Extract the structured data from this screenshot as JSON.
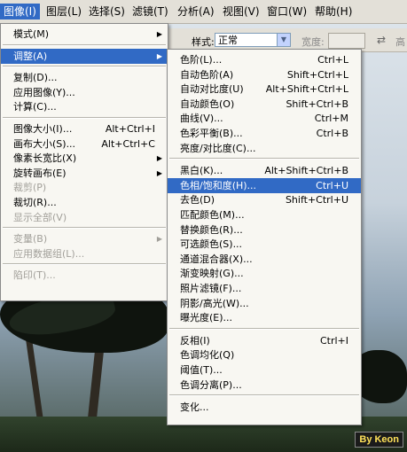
{
  "menubar": [
    {
      "label": "图像(I)",
      "active": true
    },
    {
      "label": "图层(L)"
    },
    {
      "label": "选择(S)"
    },
    {
      "label": "滤镜(T)"
    },
    {
      "label": "分析(A)"
    },
    {
      "label": "视图(V)"
    },
    {
      "label": "窗口(W)"
    },
    {
      "label": "帮助(H)"
    }
  ],
  "options_bar": {
    "style_label": "样式:",
    "style_value": "正常",
    "width_label": "宽度:",
    "height_label": "高"
  },
  "image_menu": [
    {
      "label": "模式(M)",
      "submenu": true
    },
    {
      "sep": true
    },
    {
      "label": "调整(A)",
      "submenu": true,
      "highlight": true
    },
    {
      "sep": true
    },
    {
      "label": "复制(D)..."
    },
    {
      "label": "应用图像(Y)..."
    },
    {
      "label": "计算(C)..."
    },
    {
      "sep": true
    },
    {
      "label": "图像大小(I)...",
      "shortcut": "Alt+Ctrl+I"
    },
    {
      "label": "画布大小(S)...",
      "shortcut": "Alt+Ctrl+C"
    },
    {
      "label": "像素长宽比(X)",
      "submenu": true
    },
    {
      "label": "旋转画布(E)",
      "submenu": true
    },
    {
      "label": "裁剪(P)",
      "disabled": true
    },
    {
      "label": "裁切(R)..."
    },
    {
      "label": "显示全部(V)",
      "disabled": true
    },
    {
      "sep": true
    },
    {
      "label": "变量(B)",
      "submenu": true,
      "disabled": true
    },
    {
      "label": "应用数据组(L)...",
      "disabled": true
    },
    {
      "sep": true
    },
    {
      "label": "陷印(T)...",
      "disabled": true
    }
  ],
  "adjust_menu": [
    {
      "label": "色阶(L)...",
      "shortcut": "Ctrl+L"
    },
    {
      "label": "自动色阶(A)",
      "shortcut": "Shift+Ctrl+L"
    },
    {
      "label": "自动对比度(U)",
      "shortcut": "Alt+Shift+Ctrl+L"
    },
    {
      "label": "自动颜色(O)",
      "shortcut": "Shift+Ctrl+B"
    },
    {
      "label": "曲线(V)...",
      "shortcut": "Ctrl+M"
    },
    {
      "label": "色彩平衡(B)...",
      "shortcut": "Ctrl+B"
    },
    {
      "label": "亮度/对比度(C)..."
    },
    {
      "sep": true
    },
    {
      "label": "黑白(K)...",
      "shortcut": "Alt+Shift+Ctrl+B"
    },
    {
      "label": "色相/饱和度(H)...",
      "shortcut": "Ctrl+U",
      "highlight": true
    },
    {
      "label": "去色(D)",
      "shortcut": "Shift+Ctrl+U"
    },
    {
      "label": "匹配颜色(M)..."
    },
    {
      "label": "替换颜色(R)..."
    },
    {
      "label": "可选颜色(S)..."
    },
    {
      "label": "通道混合器(X)..."
    },
    {
      "label": "渐变映射(G)..."
    },
    {
      "label": "照片滤镜(F)..."
    },
    {
      "label": "阴影/高光(W)..."
    },
    {
      "label": "曝光度(E)..."
    },
    {
      "sep": true
    },
    {
      "label": "反相(I)",
      "shortcut": "Ctrl+I"
    },
    {
      "label": "色调均化(Q)"
    },
    {
      "label": "阈值(T)..."
    },
    {
      "label": "色调分离(P)..."
    },
    {
      "sep": true
    },
    {
      "label": "变化..."
    }
  ],
  "watermark": "By Keon",
  "colors": {
    "highlight": "#316ac5",
    "menu_bg": "#f8f7f2",
    "disabled": "#a19f99"
  }
}
